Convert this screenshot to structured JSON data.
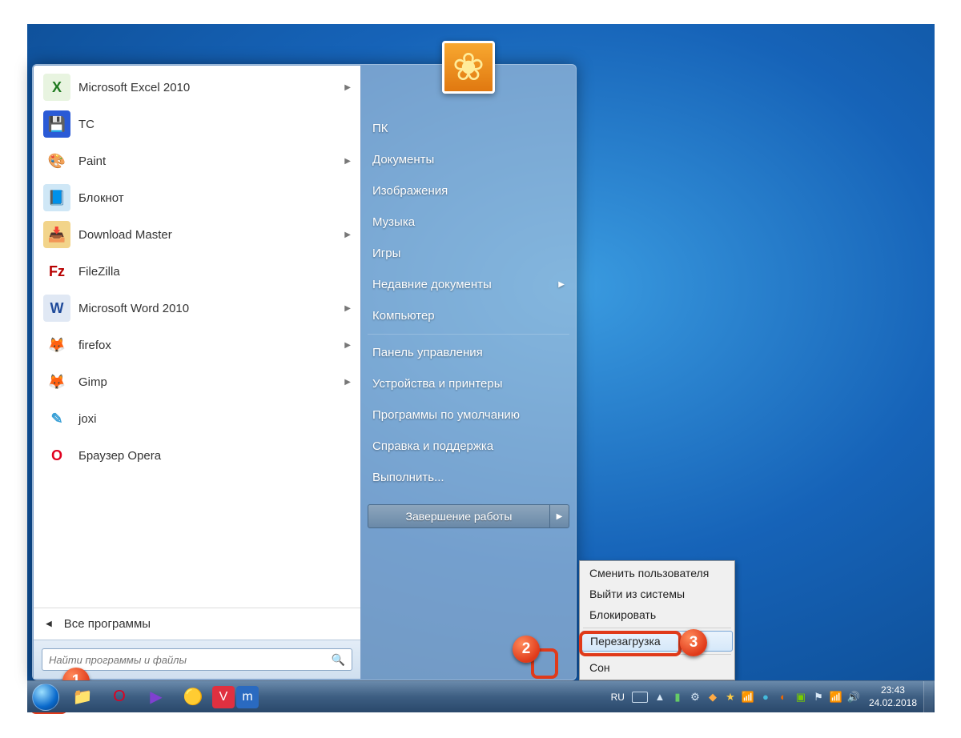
{
  "start_menu": {
    "programs": [
      {
        "label": "Microsoft Excel 2010",
        "has_flyout": true,
        "icon_bg": "#e8f4e0",
        "icon_fg": "#1f7a1f",
        "glyph": "X"
      },
      {
        "label": "TC",
        "has_flyout": false,
        "icon_bg": "#2a5ad6",
        "icon_fg": "#fff",
        "glyph": "💾"
      },
      {
        "label": "Paint",
        "has_flyout": true,
        "icon_bg": "#fff",
        "icon_fg": "#c04020",
        "glyph": "🎨"
      },
      {
        "label": "Блокнот",
        "has_flyout": false,
        "icon_bg": "#cfe7f6",
        "icon_fg": "#2558a6",
        "glyph": "📘"
      },
      {
        "label": "Download Master",
        "has_flyout": true,
        "icon_bg": "#f2d48a",
        "icon_fg": "#7a4a10",
        "glyph": "📥"
      },
      {
        "label": "FileZilla",
        "has_flyout": false,
        "icon_bg": "#fff",
        "icon_fg": "#b80000",
        "glyph": "Fz"
      },
      {
        "label": "Microsoft Word 2010",
        "has_flyout": true,
        "icon_bg": "#e0e8f4",
        "icon_fg": "#1f4a9a",
        "glyph": "W"
      },
      {
        "label": "firefox",
        "has_flyout": true,
        "icon_bg": "#fff",
        "icon_fg": "#e06a10",
        "glyph": "🦊"
      },
      {
        "label": "Gimp",
        "has_flyout": true,
        "icon_bg": "#fff",
        "icon_fg": "#4a3a2a",
        "glyph": "🦊"
      },
      {
        "label": "joxi",
        "has_flyout": false,
        "icon_bg": "#fff",
        "icon_fg": "#3aa0d6",
        "glyph": "✎"
      },
      {
        "label": "Браузер Opera",
        "has_flyout": false,
        "icon_bg": "#fff",
        "icon_fg": "#e00020",
        "glyph": "O"
      }
    ],
    "all_programs": "Все программы",
    "search_placeholder": "Найти программы и файлы",
    "right_items": [
      {
        "label": "ПК"
      },
      {
        "label": "Документы"
      },
      {
        "label": "Изображения"
      },
      {
        "label": "Музыка"
      },
      {
        "label": "Игры"
      },
      {
        "label": "Недавние документы",
        "has_flyout": true
      },
      {
        "label": "Компьютер"
      },
      {
        "sep": true
      },
      {
        "label": "Панель управления"
      },
      {
        "label": "Устройства и принтеры"
      },
      {
        "label": "Программы по умолчанию"
      },
      {
        "label": "Справка и поддержка"
      },
      {
        "label": "Выполнить..."
      }
    ],
    "shutdown_label": "Завершение работы"
  },
  "submenu": {
    "items": [
      {
        "label": "Сменить пользователя"
      },
      {
        "label": "Выйти из системы"
      },
      {
        "label": "Блокировать"
      },
      {
        "sep": true
      },
      {
        "label": "Перезагрузка",
        "highlight": true
      },
      {
        "sep": true
      },
      {
        "label": "Сон"
      }
    ]
  },
  "callouts": {
    "1": "1",
    "2": "2",
    "3": "3"
  },
  "taskbar": {
    "lang": "RU",
    "time": "23:43",
    "date": "24.02.2018"
  }
}
